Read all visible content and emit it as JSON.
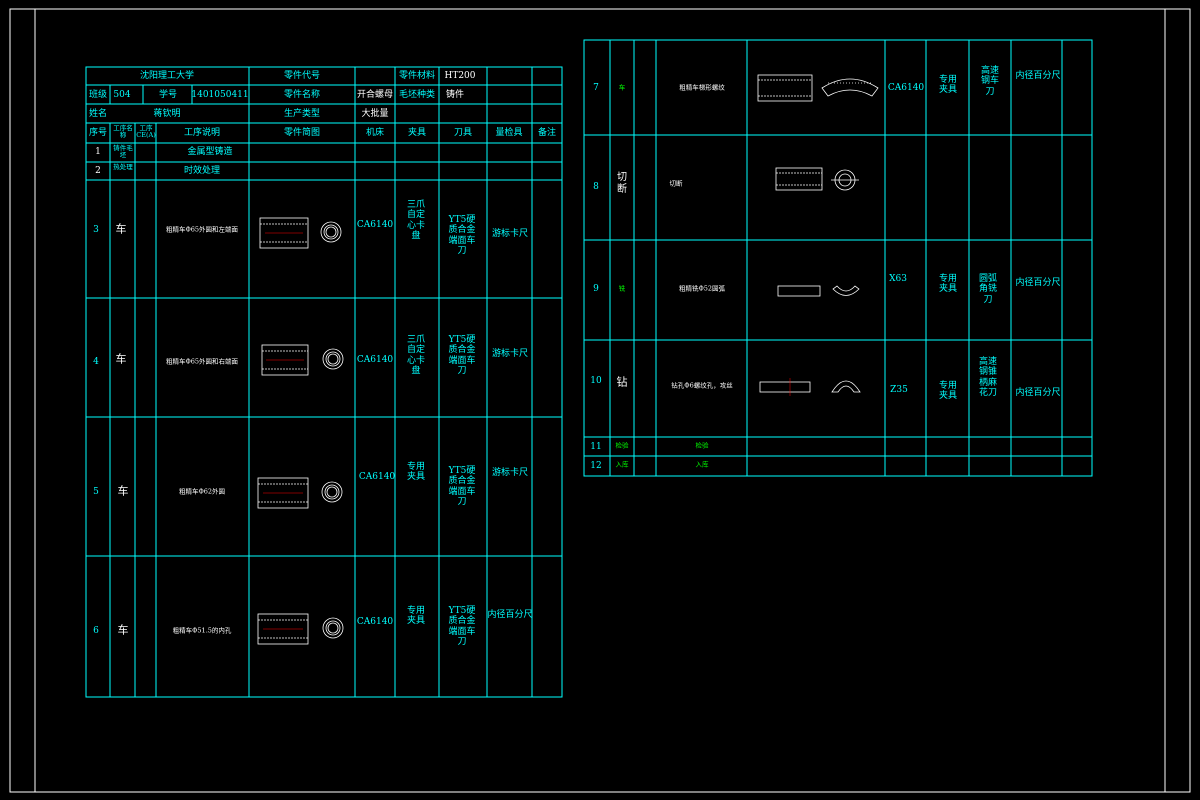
{
  "colors": {
    "background": "#000000",
    "grid": "#00ffff",
    "text": "#ffffff",
    "highlight": "#00ffff",
    "step_highlight": "#00ff00",
    "accent": "#ff0000"
  },
  "header": {
    "school": "沈阳理工大学",
    "part_code_label": "零件代号",
    "part_material_label": "零件材料",
    "part_material_value": "HT200",
    "class_label": "班级",
    "class_value": "504",
    "student_id_label": "学号",
    "student_id_value": "1401050411",
    "part_name_label": "零件名称",
    "split_label": "开合螺母",
    "blank_type_label": "毛坯种类",
    "blank_type_value": "铸件",
    "name_label": "姓名",
    "name_value": "蒋钦明",
    "production_type_label": "生产类型",
    "production_type_value": "大批量"
  },
  "columns": {
    "seq": "序号",
    "proc_name": "工序名称",
    "proc_content": "工序 CE(A)",
    "proc_desc": "工序说明",
    "sketch": "零件简图",
    "machine": "机床",
    "fixture": "夹具",
    "tool": "刀具",
    "gauge": "量检具",
    "note": "备注"
  },
  "left_rows": [
    {
      "seq": "1",
      "op": "铸件毛坯",
      "desc": "金属型铸造"
    },
    {
      "seq": "2",
      "op": "热处理",
      "desc": "时效处理"
    },
    {
      "seq": "3",
      "op": "车",
      "desc": "粗精车Φ65外圆和左端面",
      "machine": "CA6140",
      "fixture": "三爪自定心卡盘",
      "tool": "YT5硬质合金端面车刀",
      "gauge": "游标卡尺"
    },
    {
      "seq": "4",
      "op": "车",
      "desc": "粗精车Φ65外圆和右端面",
      "machine": "CA6140",
      "fixture": "三爪自定心卡盘",
      "tool": "YT5硬质合金端面车刀",
      "gauge": "游标卡尺"
    },
    {
      "seq": "5",
      "op": "车",
      "desc": "粗精车Φ62外圆",
      "machine": "CA6140",
      "fixture": "专用夹具",
      "tool": "YT5硬质合金端面车刀",
      "gauge": "游标卡尺"
    },
    {
      "seq": "6",
      "op": "车",
      "desc": "粗精车Φ51.5的内孔",
      "machine": "CA6140",
      "fixture": "专用夹具",
      "tool": "YT5硬质合金端面车刀",
      "gauge": "内径百分尺"
    }
  ],
  "right_rows": [
    {
      "seq": "7",
      "op": "车",
      "desc": "粗精车梯形螺纹",
      "machine": "CA6140",
      "fixture": "专用夹具",
      "tool": "高速钢车刀",
      "gauge": "内径百分尺"
    },
    {
      "seq": "8",
      "op": "切断",
      "desc": "切断"
    },
    {
      "seq": "9",
      "op": "铣",
      "desc": "粗精铣Φ52圆弧",
      "machine": "X63",
      "fixture": "专用夹具",
      "tool": "圆弧角铣刀",
      "gauge": "内径百分尺"
    },
    {
      "seq": "10",
      "op": "钻",
      "desc": "钻孔Φ6螺纹孔，攻丝",
      "machine": "Z35",
      "fixture": "专用夹具",
      "tool": "高速钢锥柄麻花刀",
      "gauge": "内径百分尺"
    },
    {
      "seq": "11",
      "op": "检验",
      "desc": "检验"
    },
    {
      "seq": "12",
      "op": "入库",
      "desc": "入库"
    }
  ]
}
